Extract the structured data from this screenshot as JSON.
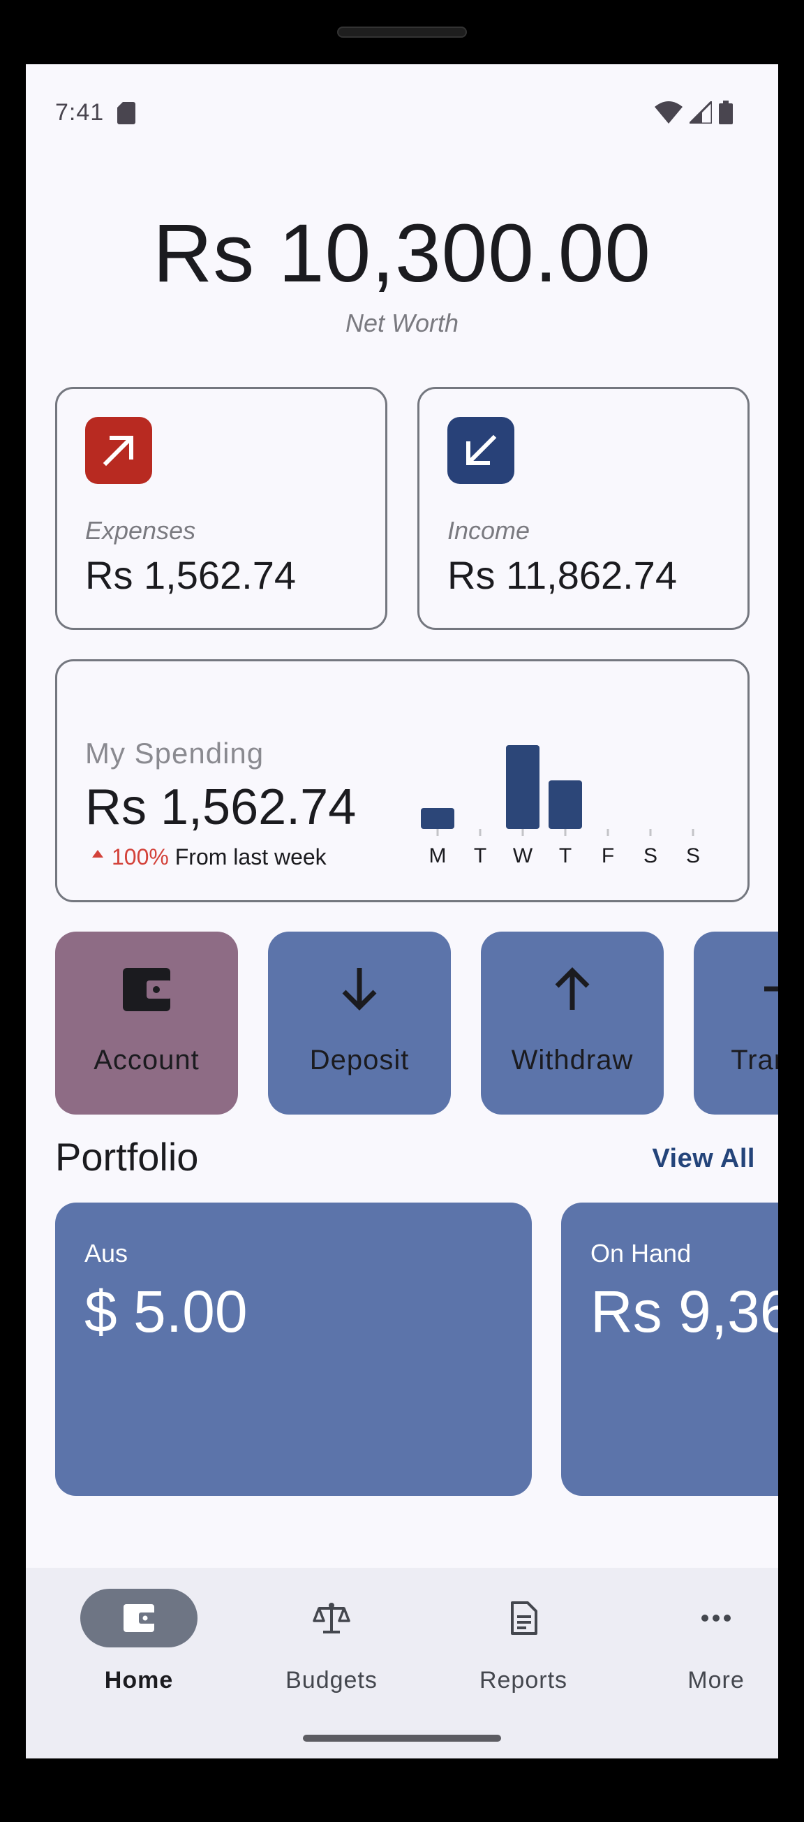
{
  "status_bar": {
    "time": "7:41"
  },
  "net_worth": {
    "amount": "Rs 10,300.00",
    "label": "Net Worth"
  },
  "expenses": {
    "label": "Expenses",
    "value": "Rs 1,562.74",
    "color": "#b82a21"
  },
  "income": {
    "label": "Income",
    "value": "Rs 11,862.74",
    "color": "#284178"
  },
  "spending": {
    "title": "My Spending",
    "value": "Rs 1,562.74",
    "change_pct": "100%",
    "change_text": "From last week",
    "bar_color": "#2c4678",
    "trend_color": "#d3423a"
  },
  "chart_data": {
    "type": "bar",
    "categories": [
      "M",
      "T",
      "W",
      "T",
      "F",
      "S",
      "S"
    ],
    "values": [
      0.25,
      0,
      1.0,
      0.58,
      0,
      0,
      0
    ],
    "title": "",
    "xlabel": "",
    "ylabel": "",
    "ylim": [
      0,
      1
    ],
    "grid": false
  },
  "actions": [
    {
      "label": "Account",
      "icon": "wallet-icon",
      "color": "#8e6c85"
    },
    {
      "label": "Deposit",
      "icon": "arrow-down-icon",
      "color": "#5c74aa"
    },
    {
      "label": "Withdraw",
      "icon": "arrow-up-icon",
      "color": "#5c74aa"
    },
    {
      "label": "Transfer",
      "icon": "arrow-right-icon",
      "color": "#5c74aa"
    }
  ],
  "portfolio": {
    "title": "Portfolio",
    "view_all": "View All",
    "items": [
      {
        "name": "Aus",
        "amount": "$ 5.00"
      },
      {
        "name": "On Hand",
        "amount": "Rs 9,36"
      }
    ]
  },
  "nav": {
    "items": [
      {
        "label": "Home",
        "icon": "wallet-icon",
        "active": true
      },
      {
        "label": "Budgets",
        "icon": "scale-icon",
        "active": false
      },
      {
        "label": "Reports",
        "icon": "document-icon",
        "active": false
      },
      {
        "label": "More",
        "icon": "more-dots-icon",
        "active": false
      }
    ]
  }
}
